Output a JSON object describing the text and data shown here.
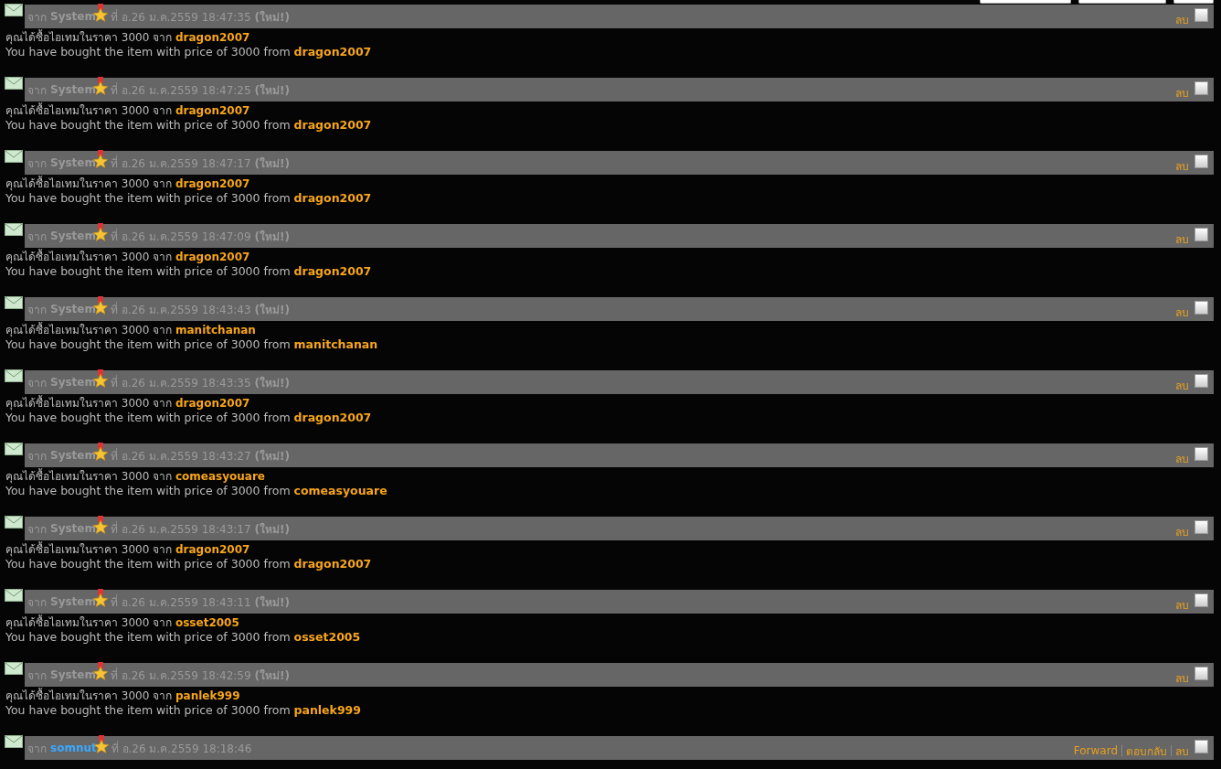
{
  "top_buttons": [
    {
      "selected": false
    },
    {
      "selected": false
    },
    {
      "selected": false
    }
  ],
  "messages": [
    {
      "from_label": "จาก",
      "sender": "System",
      "kind": "system",
      "date": "ที่ อ.26 ม.ค.2559 18:47:35",
      "new_label": "(ใหม่!)",
      "actions": [
        "ลบ"
      ],
      "checked": false,
      "body": [
        "คุณได้ซื้อไอเทมในราคา 3000 จาก **dragon2007**",
        "You have bought the item with price of 3000 from **dragon2007**"
      ]
    },
    {
      "from_label": "จาก",
      "sender": "System",
      "kind": "system",
      "date": "ที่ อ.26 ม.ค.2559 18:47:25",
      "new_label": "(ใหม่!)",
      "actions": [
        "ลบ"
      ],
      "checked": false,
      "body": [
        "คุณได้ซื้อไอเทมในราคา 3000 จาก **dragon2007**",
        "You have bought the item with price of 3000 from **dragon2007**"
      ]
    },
    {
      "from_label": "จาก",
      "sender": "System",
      "kind": "system",
      "date": "ที่ อ.26 ม.ค.2559 18:47:17",
      "new_label": "(ใหม่!)",
      "actions": [
        "ลบ"
      ],
      "checked": false,
      "body": [
        "คุณได้ซื้อไอเทมในราคา 3000 จาก **dragon2007**",
        "You have bought the item with price of 3000 from **dragon2007**"
      ]
    },
    {
      "from_label": "จาก",
      "sender": "System",
      "kind": "system",
      "date": "ที่ อ.26 ม.ค.2559 18:47:09",
      "new_label": "(ใหม่!)",
      "actions": [
        "ลบ"
      ],
      "checked": false,
      "body": [
        "คุณได้ซื้อไอเทมในราคา 3000 จาก **dragon2007**",
        "You have bought the item with price of 3000 from **dragon2007**"
      ]
    },
    {
      "from_label": "จาก",
      "sender": "System",
      "kind": "system",
      "date": "ที่ อ.26 ม.ค.2559 18:43:43",
      "new_label": "(ใหม่!)",
      "actions": [
        "ลบ"
      ],
      "checked": false,
      "body": [
        "คุณได้ซื้อไอเทมในราคา 3000 จาก **manitchanan**",
        "You have bought the item with price of 3000 from **manitchanan**"
      ]
    },
    {
      "from_label": "จาก",
      "sender": "System",
      "kind": "system",
      "date": "ที่ อ.26 ม.ค.2559 18:43:35",
      "new_label": "(ใหม่!)",
      "actions": [
        "ลบ"
      ],
      "checked": false,
      "body": [
        "คุณได้ซื้อไอเทมในราคา 3000 จาก **dragon2007**",
        "You have bought the item with price of 3000 from **dragon2007**"
      ]
    },
    {
      "from_label": "จาก",
      "sender": "System",
      "kind": "system",
      "date": "ที่ อ.26 ม.ค.2559 18:43:27",
      "new_label": "(ใหม่!)",
      "actions": [
        "ลบ"
      ],
      "checked": false,
      "body": [
        "คุณได้ซื้อไอเทมในราคา 3000 จาก **comeasyouare**",
        "You have bought the item with price of 3000 from **comeasyouare**"
      ]
    },
    {
      "from_label": "จาก",
      "sender": "System",
      "kind": "system",
      "date": "ที่ อ.26 ม.ค.2559 18:43:17",
      "new_label": "(ใหม่!)",
      "actions": [
        "ลบ"
      ],
      "checked": false,
      "body": [
        "คุณได้ซื้อไอเทมในราคา 3000 จาก **dragon2007**",
        "You have bought the item with price of 3000 from **dragon2007**"
      ]
    },
    {
      "from_label": "จาก",
      "sender": "System",
      "kind": "system",
      "date": "ที่ อ.26 ม.ค.2559 18:43:11",
      "new_label": "(ใหม่!)",
      "actions": [
        "ลบ"
      ],
      "checked": false,
      "body": [
        "คุณได้ซื้อไอเทมในราคา 3000 จาก **osset2005**",
        "You have bought the item with price of 3000 from **osset2005**"
      ]
    },
    {
      "from_label": "จาก",
      "sender": "System",
      "kind": "system",
      "date": "ที่ อ.26 ม.ค.2559 18:42:59",
      "new_label": "(ใหม่!)",
      "actions": [
        "ลบ"
      ],
      "checked": false,
      "body": [
        "คุณได้ซื้อไอเทมในราคา 3000 จาก **panlek999**",
        "You have bought the item with price of 3000 from **panlek999**"
      ]
    },
    {
      "from_label": "จาก",
      "sender": "somnut",
      "kind": "user",
      "date": "ที่ อ.26 ม.ค.2559 18:18:46",
      "actions": [
        "Forward",
        "ตอบกลับ",
        "ลบ"
      ],
      "checked": false
    }
  ]
}
